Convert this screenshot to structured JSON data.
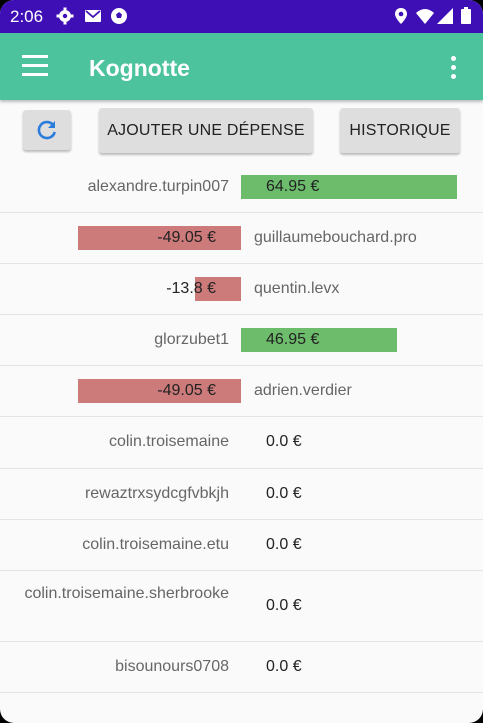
{
  "status": {
    "time": "2:06",
    "icons": [
      "settings-icon",
      "mail-icon",
      "soccer-ball-icon",
      "location-icon",
      "wifi-icon",
      "signal-icon",
      "battery-icon"
    ]
  },
  "appbar": {
    "title": "Kognotte"
  },
  "buttons": {
    "refresh_icon": "refresh-icon",
    "add_expense": "AJOUTER UNE DÉPENSE",
    "history": "HISTORIQUE"
  },
  "balances": [
    {
      "name": "alexandre.turpin007",
      "amount": "64.95 €",
      "value": 64.95
    },
    {
      "name": "guillaumebouchard.pro",
      "amount": "-49.05 €",
      "value": -49.05
    },
    {
      "name": "quentin.levx",
      "amount": "-13.8 €",
      "value": -13.8
    },
    {
      "name": "glorzubet1",
      "amount": "46.95 €",
      "value": 46.95
    },
    {
      "name": "adrien.verdier",
      "amount": "-49.05 €",
      "value": -49.05
    },
    {
      "name": "colin.troisemaine",
      "amount": "0.0 €",
      "value": 0
    },
    {
      "name": "rewaztrxsydcgfvbkjh",
      "amount": "0.0 €",
      "value": 0
    },
    {
      "name": "colin.troisemaine.etu",
      "amount": "0.0 €",
      "value": 0
    },
    {
      "name": "colin.troisemaine.sherbrooke",
      "amount": "0.0 €",
      "value": 0
    },
    {
      "name": "bisounours0708",
      "amount": "0.0 €",
      "value": 0
    }
  ],
  "colors": {
    "statusbar": "#3f0fb6",
    "appbar": "#4cc29d",
    "positive": "#6cbc6c",
    "negative": "#cd7a7a"
  }
}
